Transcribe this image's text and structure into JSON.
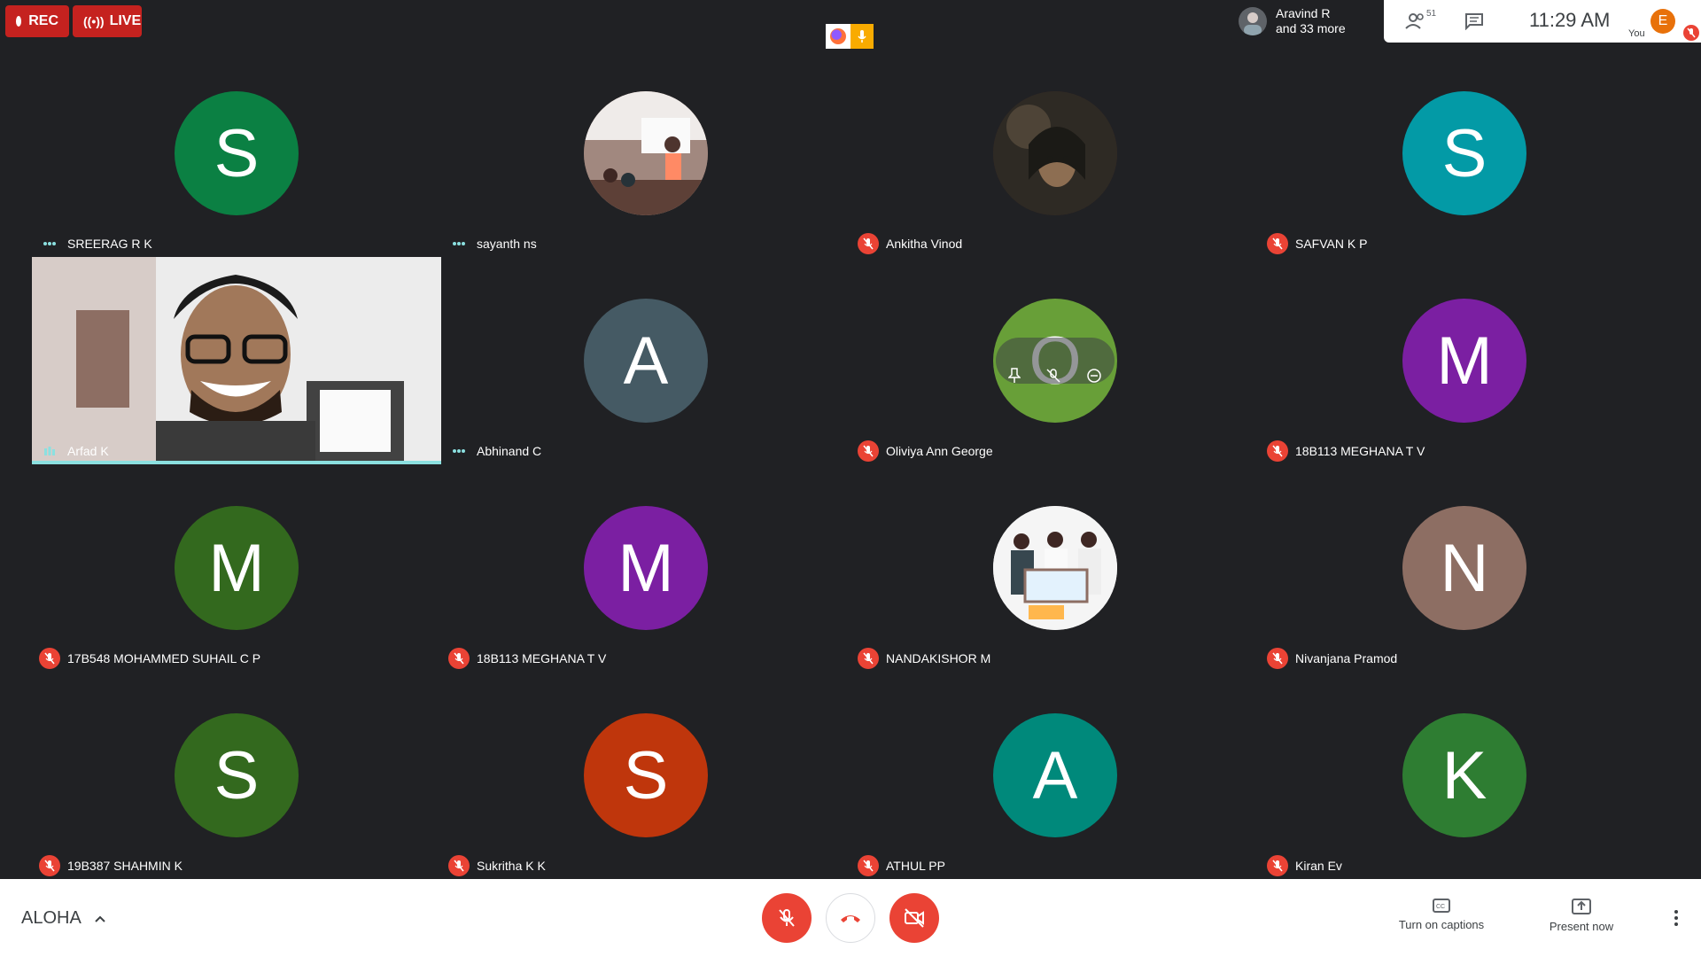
{
  "topbar": {
    "rec_label": "REC",
    "live_label": "LIVE",
    "presenter_name": "Aravind R",
    "presenter_more": "and 33 more",
    "participants_count": "51",
    "clock": "11:29  AM",
    "you_initial": "E",
    "you_label": "You"
  },
  "tiles": [
    {
      "name": "SREERAG R K",
      "initial": "S",
      "color": "#0b8043",
      "status": "speaking-dots"
    },
    {
      "name": "sayanth ns",
      "initial": "",
      "color": "#8d6e63",
      "status": "speaking-dots",
      "photo": true
    },
    {
      "name": "Ankitha Vinod",
      "initial": "",
      "color": "#3e2723",
      "status": "muted",
      "photo": true
    },
    {
      "name": "SAFVAN K P",
      "initial": "S",
      "color": "#039aa6",
      "status": "muted"
    },
    {
      "name": "Arfad K",
      "initial": "",
      "color": "#e9e9e9",
      "status": "speaking-bars",
      "video": true
    },
    {
      "name": "Abhinand C",
      "initial": "A",
      "color": "#455a64",
      "status": "speaking-dots"
    },
    {
      "name": "Oliviya Ann George",
      "initial": "O",
      "color": "#689f38",
      "status": "muted",
      "hover": true
    },
    {
      "name": "18B113 MEGHANA T V",
      "initial": "M",
      "color": "#7b1fa2",
      "status": "muted"
    },
    {
      "name": "17B548 MOHAMMED SUHAIL C P",
      "initial": "M",
      "color": "#33691e",
      "status": "muted"
    },
    {
      "name": "18B113 MEGHANA T V",
      "initial": "M",
      "color": "#7b1fa2",
      "status": "muted"
    },
    {
      "name": "NANDAKISHOR M",
      "initial": "",
      "color": "#e0e0e0",
      "status": "muted",
      "photo": true
    },
    {
      "name": "Nivanjana Pramod",
      "initial": "N",
      "color": "#8d6e63",
      "status": "muted"
    },
    {
      "name": "19B387 SHAHMIN K",
      "initial": "S",
      "color": "#33691e",
      "status": "muted"
    },
    {
      "name": "Sukritha K K",
      "initial": "S",
      "color": "#bf360c",
      "status": "muted"
    },
    {
      "name": "ATHUL PP",
      "initial": "A",
      "color": "#00897b",
      "status": "muted"
    },
    {
      "name": "Kiran Ev",
      "initial": "K",
      "color": "#2e7d32",
      "status": "muted"
    }
  ],
  "bottombar": {
    "meeting_title": "ALOHA",
    "captions_label": "Turn on captions",
    "present_label": "Present now"
  },
  "icons": {
    "mic_off": "mic-off-icon",
    "end_call": "phone-hangup-icon",
    "cam_off": "camera-off-icon",
    "captions": "cc-icon",
    "present": "present-screen-icon",
    "more": "more-vert-icon",
    "people": "people-icon",
    "chat": "chat-icon"
  }
}
